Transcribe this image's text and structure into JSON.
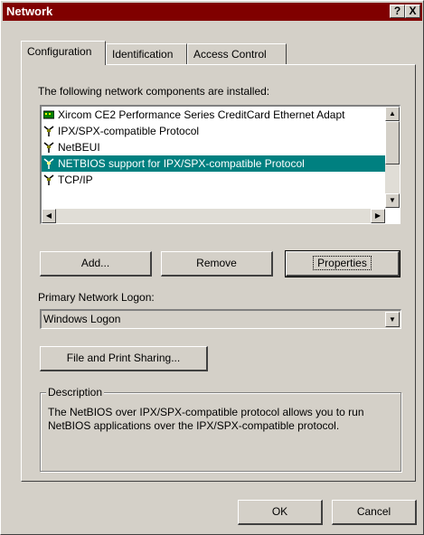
{
  "window": {
    "title": "Network",
    "help_glyph": "?",
    "close_glyph": "X"
  },
  "tabs": [
    {
      "label": "Configuration",
      "active": true
    },
    {
      "label": "Identification",
      "active": false
    },
    {
      "label": "Access Control",
      "active": false
    }
  ],
  "components": {
    "heading": "The following network components are installed:",
    "items": [
      {
        "label": "Xircom CE2 Performance Series CreditCard Ethernet Adapt",
        "icon": "adapter-icon",
        "selected": false
      },
      {
        "label": "IPX/SPX-compatible Protocol",
        "icon": "protocol-icon",
        "selected": false
      },
      {
        "label": "NetBEUI",
        "icon": "protocol-icon",
        "selected": false
      },
      {
        "label": "NETBIOS support for IPX/SPX-compatible Protocol",
        "icon": "protocol-icon",
        "selected": true
      },
      {
        "label": "TCP/IP",
        "icon": "protocol-icon",
        "selected": false
      }
    ]
  },
  "buttons": {
    "add": "Add...",
    "remove": "Remove",
    "properties": "Properties",
    "file_print": "File and Print Sharing...",
    "ok": "OK",
    "cancel": "Cancel"
  },
  "logon": {
    "label": "Primary Network Logon:",
    "value": "Windows Logon"
  },
  "description": {
    "legend": "Description",
    "text": "The NetBIOS over IPX/SPX-compatible protocol allows you to run NetBIOS applications over the IPX/SPX-compatible protocol."
  },
  "colors": {
    "title_bar": "#800000",
    "selection": "#008080",
    "face": "#d4d0c8"
  }
}
